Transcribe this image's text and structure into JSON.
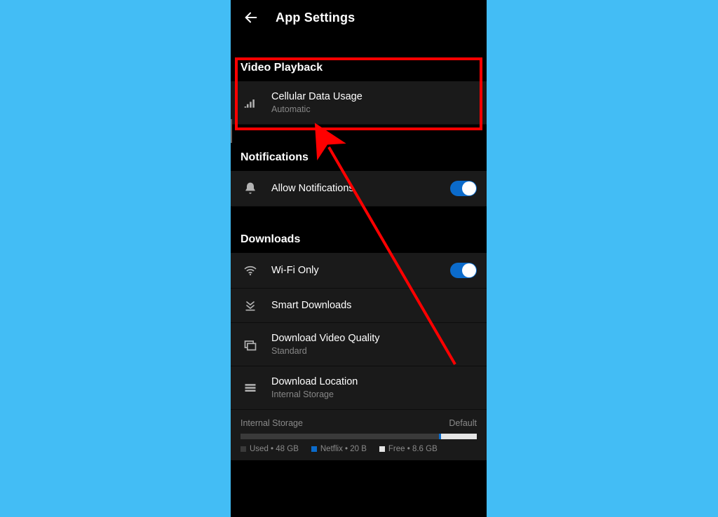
{
  "header": {
    "title": "App Settings"
  },
  "sections": {
    "video_playback": {
      "title": "Video Playback",
      "cellular": {
        "label": "Cellular Data Usage",
        "value": "Automatic"
      }
    },
    "notifications": {
      "title": "Notifications",
      "allow": {
        "label": "Allow Notifications"
      }
    },
    "downloads": {
      "title": "Downloads",
      "wifi": {
        "label": "Wi-Fi Only"
      },
      "smart": {
        "label": "Smart Downloads"
      },
      "quality": {
        "label": "Download Video Quality",
        "value": "Standard"
      },
      "location": {
        "label": "Download Location",
        "value": "Internal Storage"
      }
    },
    "storage": {
      "name": "Internal Storage",
      "mode": "Default",
      "legend": {
        "used": "Used • 48 GB",
        "netflix": "Netflix • 20 B",
        "free": "Free • 8.6 GB"
      }
    }
  },
  "colors": {
    "accent": "#0b6bcb",
    "highlight": "#ff0000"
  }
}
